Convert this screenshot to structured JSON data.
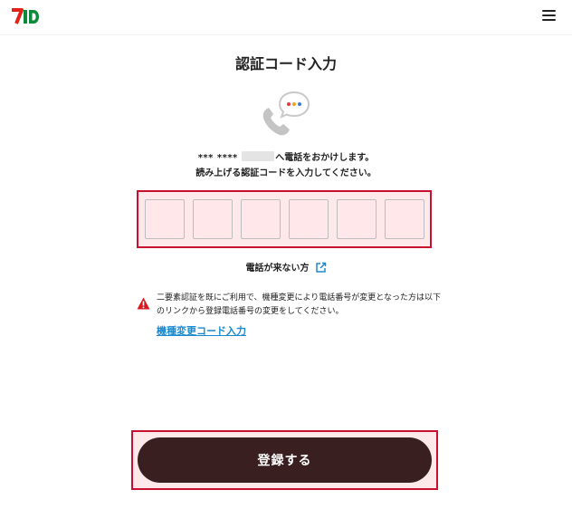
{
  "header": {
    "logo_text": "7iD",
    "logo_icon": "seven-id-logo",
    "menu_icon": "hamburger-menu-icon"
  },
  "page": {
    "title": "認証コード入力",
    "illustration_icon": "phone-speech-bubble-icon"
  },
  "instruction": {
    "masked_number": "*** ****",
    "line1_suffix": "へ電話をおかけします。",
    "line2": "読み上げる認証コードを入力してください。"
  },
  "code_input": {
    "digit_count": 6,
    "values": [
      "",
      "",
      "",
      "",
      "",
      ""
    ]
  },
  "no_call": {
    "label": "電話が来ない方",
    "icon": "external-link-icon"
  },
  "notice": {
    "icon": "warning-icon",
    "text": "二要素認証を既にご利用で、機種変更により電話番号が変更となった方は以下のリンクから登録電話番号の変更をしてください。",
    "link_label": "機種変更コード入力"
  },
  "submit": {
    "label": "登録する"
  },
  "colors": {
    "primary_button": "#3a1f21",
    "highlight_border": "#c8102e",
    "highlight_fill": "#fde8ea",
    "link": "#1a8bd1",
    "warning": "#d71920",
    "logo_red": "#e2231a",
    "logo_green": "#0a8a3a"
  }
}
